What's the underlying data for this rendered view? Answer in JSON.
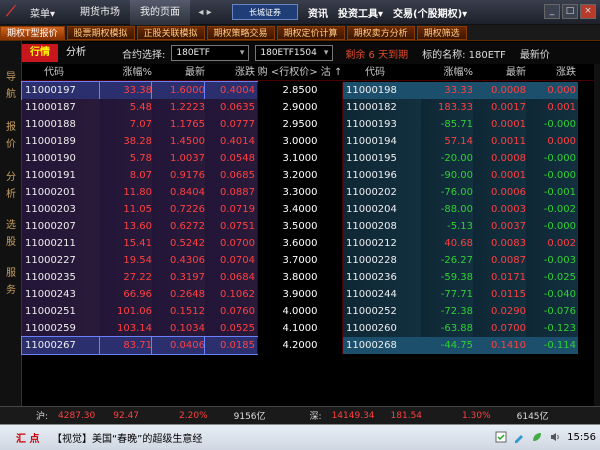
{
  "titlebar": {
    "menu_label": "菜单▾",
    "tabs": [
      "期货市场",
      "我的页面"
    ],
    "brand": "长城证券",
    "menus": [
      "资讯",
      "投资工具▾",
      "交易(个股期权)▾"
    ],
    "win_min": "_",
    "win_max": "□",
    "win_close": "×"
  },
  "func_tabs": [
    "期权T型报价",
    "股票期权模拟",
    "正股关联模拟",
    "期权策略交易",
    "期权定价计算",
    "期权卖方分析",
    "期权筛选"
  ],
  "sidebar": [
    "导",
    "航",
    "报",
    "价",
    "分",
    "析",
    "选",
    "股",
    "服",
    "务"
  ],
  "toolbar": {
    "quote_btn": "行情",
    "analysis_btn": "分析",
    "contract_label": "合约选择:",
    "contract_value": "180ETF",
    "month_value": "180ETF1504",
    "remain_text": "剩余 6 天到期",
    "underlying_label": "标的名称: 180ETF",
    "latest_label": "最新价"
  },
  "headers": {
    "code": "代码",
    "pct": "涨幅%",
    "price": "最新",
    "chg": "涨跌",
    "strike": "购 <行权价> 沽 ↑",
    "code2": "代码",
    "pct2": "涨幅%",
    "price2": "最新",
    "chg2": "涨跌"
  },
  "rows": [
    {
      "c_code": "11000197",
      "c_pct": "33.38",
      "c_price": "1.6000",
      "c_chg": "0.4004",
      "strike": "2.8500",
      "p_code": "11000198",
      "p_pct": "33.33",
      "p_price": "0.0008",
      "p_chg": "0.000"
    },
    {
      "c_code": "11000187",
      "c_pct": "5.48",
      "c_price": "1.2223",
      "c_chg": "0.0635",
      "strike": "2.9000",
      "p_code": "11000182",
      "p_pct": "183.33",
      "p_price": "0.0017",
      "p_chg": "0.001"
    },
    {
      "c_code": "11000188",
      "c_pct": "7.07",
      "c_price": "1.1765",
      "c_chg": "0.0777",
      "strike": "2.9500",
      "p_code": "11000193",
      "p_pct": "-85.71",
      "p_price": "0.0001",
      "p_chg": "-0.000"
    },
    {
      "c_code": "11000189",
      "c_pct": "38.28",
      "c_price": "1.4500",
      "c_chg": "0.4014",
      "strike": "3.0000",
      "p_code": "11000194",
      "p_pct": "57.14",
      "p_price": "0.0011",
      "p_chg": "0.000"
    },
    {
      "c_code": "11000190",
      "c_pct": "5.78",
      "c_price": "1.0037",
      "c_chg": "0.0548",
      "strike": "3.1000",
      "p_code": "11000195",
      "p_pct": "-20.00",
      "p_price": "0.0008",
      "p_chg": "-0.000"
    },
    {
      "c_code": "11000191",
      "c_pct": "8.07",
      "c_price": "0.9176",
      "c_chg": "0.0685",
      "strike": "3.2000",
      "p_code": "11000196",
      "p_pct": "-90.00",
      "p_price": "0.0001",
      "p_chg": "-0.000"
    },
    {
      "c_code": "11000201",
      "c_pct": "11.80",
      "c_price": "0.8404",
      "c_chg": "0.0887",
      "strike": "3.3000",
      "p_code": "11000202",
      "p_pct": "-76.00",
      "p_price": "0.0006",
      "p_chg": "-0.001"
    },
    {
      "c_code": "11000203",
      "c_pct": "11.05",
      "c_price": "0.7226",
      "c_chg": "0.0719",
      "strike": "3.4000",
      "p_code": "11000204",
      "p_pct": "-88.00",
      "p_price": "0.0003",
      "p_chg": "-0.002"
    },
    {
      "c_code": "11000207",
      "c_pct": "13.60",
      "c_price": "0.6272",
      "c_chg": "0.0751",
      "strike": "3.5000",
      "p_code": "11000208",
      "p_pct": "-5.13",
      "p_price": "0.0037",
      "p_chg": "-0.000"
    },
    {
      "c_code": "11000211",
      "c_pct": "15.41",
      "c_price": "0.5242",
      "c_chg": "0.0700",
      "strike": "3.6000",
      "p_code": "11000212",
      "p_pct": "40.68",
      "p_price": "0.0083",
      "p_chg": "0.002"
    },
    {
      "c_code": "11000227",
      "c_pct": "19.54",
      "c_price": "0.4306",
      "c_chg": "0.0704",
      "strike": "3.7000",
      "p_code": "11000228",
      "p_pct": "-26.27",
      "p_price": "0.0087",
      "p_chg": "-0.003"
    },
    {
      "c_code": "11000235",
      "c_pct": "27.22",
      "c_price": "0.3197",
      "c_chg": "0.0684",
      "strike": "3.8000",
      "p_code": "11000236",
      "p_pct": "-59.38",
      "p_price": "0.0171",
      "p_chg": "-0.025"
    },
    {
      "c_code": "11000243",
      "c_pct": "66.96",
      "c_price": "0.2648",
      "c_chg": "0.1062",
      "strike": "3.9000",
      "p_code": "11000244",
      "p_pct": "-77.71",
      "p_price": "0.0115",
      "p_chg": "-0.040"
    },
    {
      "c_code": "11000251",
      "c_pct": "101.06",
      "c_price": "0.1512",
      "c_chg": "0.0760",
      "strike": "4.0000",
      "p_code": "11000252",
      "p_pct": "-72.38",
      "p_price": "0.0290",
      "p_chg": "-0.076"
    },
    {
      "c_code": "11000259",
      "c_pct": "103.14",
      "c_price": "0.1034",
      "c_chg": "0.0525",
      "strike": "4.1000",
      "p_code": "11000260",
      "p_pct": "-63.88",
      "p_price": "0.0700",
      "p_chg": "-0.123"
    },
    {
      "c_code": "11000267",
      "c_pct": "83.71",
      "c_price": "0.0406",
      "c_chg": "0.0185",
      "strike": "4.2000",
      "p_code": "11000268",
      "p_pct": "-44.75",
      "p_price": "0.1410",
      "p_chg": "-0.114"
    }
  ],
  "statusbar": {
    "sh_label": "沪:",
    "sh_index": "4287.30",
    "sh_chg": "92.47",
    "sh_pct": "2.20%",
    "sh_vol": "9156亿",
    "sz_label": "深:",
    "sz_index": "14149.34",
    "sz_chg": "181.54",
    "sz_pct": "1.30%",
    "sz_vol": "6145亿"
  },
  "ticker": {
    "label": "汇 点",
    "text": "【视觉】美国“春晚”的超级生意经",
    "time": "15:56"
  },
  "colors": {
    "up": "#ff4040",
    "down": "#30d030",
    "accent": "#c8161d"
  }
}
